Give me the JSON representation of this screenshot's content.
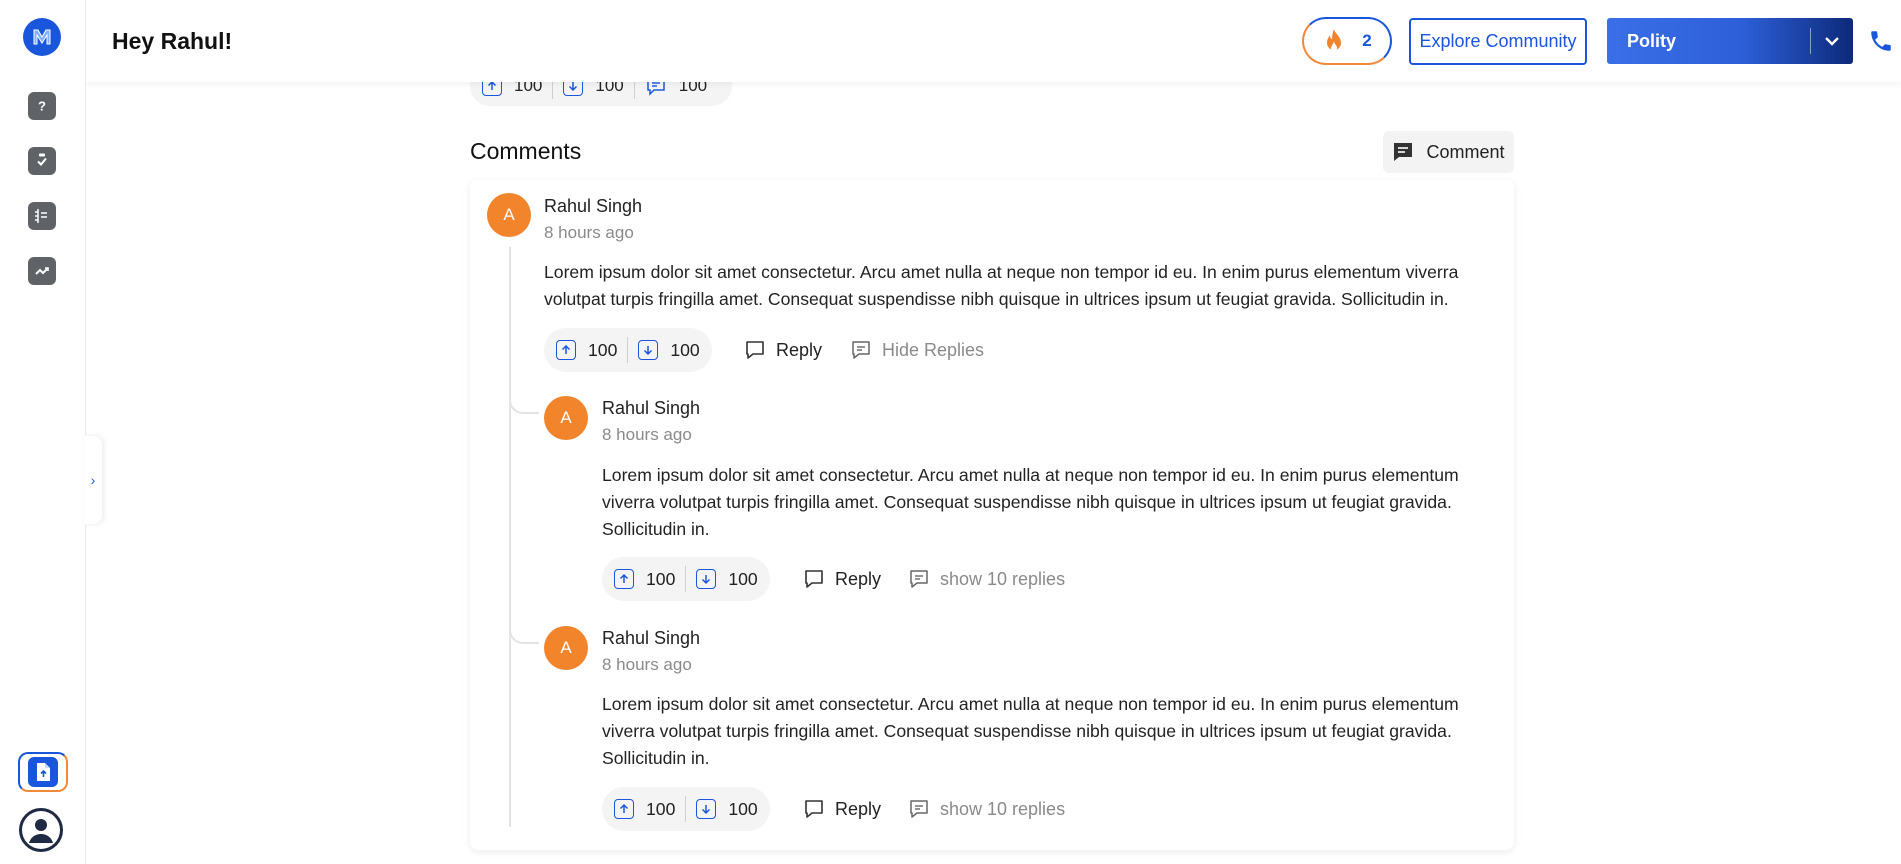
{
  "app": {
    "greeting": "Hey Rahul!",
    "logo_letter": "M",
    "brand_color": "#1a56db",
    "accent_color": "#f2842c"
  },
  "header": {
    "streak_count": "2",
    "explore_label": "Explore Community",
    "dropdown_label": "Polity"
  },
  "sidebar": {
    "items": [
      {
        "icon": "question-icon"
      },
      {
        "icon": "clipboard-check-icon"
      },
      {
        "icon": "notebook-icon"
      },
      {
        "icon": "trend-chart-icon"
      }
    ],
    "toggle_glyph": "›"
  },
  "post_votes": {
    "up": "100",
    "down": "100",
    "comments": "100"
  },
  "comments_section": {
    "title": "Comments",
    "comment_button": "Comment"
  },
  "comments": [
    {
      "avatar_initial": "A",
      "author": "Rahul Singh",
      "time": "8 hours ago",
      "text": "Lorem ipsum dolor sit amet consectetur. Arcu amet nulla at neque non tempor id eu. In enim purus elementum viverra volutpat turpis fringilla amet. Consequat suspendisse nibh quisque in ultrices ipsum ut feugiat gravida. Sollicitudin in.",
      "up": "100",
      "down": "100",
      "reply_label": "Reply",
      "replies_label": "Hide Replies"
    },
    {
      "avatar_initial": "A",
      "author": "Rahul Singh",
      "time": "8 hours ago",
      "text": "Lorem ipsum dolor sit amet consectetur. Arcu amet nulla at neque non tempor id eu. In enim purus elementum viverra volutpat turpis fringilla amet. Consequat suspendisse nibh quisque in ultrices ipsum ut feugiat gravida. Sollicitudin in.",
      "up": "100",
      "down": "100",
      "reply_label": "Reply",
      "replies_label": "show 10 replies"
    },
    {
      "avatar_initial": "A",
      "author": "Rahul Singh",
      "time": "8 hours ago",
      "text": "Lorem ipsum dolor sit amet consectetur. Arcu amet nulla at neque non tempor id eu. In enim purus elementum viverra volutpat turpis fringilla amet. Consequat suspendisse nibh quisque in ultrices ipsum ut feugiat gravida. Sollicitudin in.",
      "up": "100",
      "down": "100",
      "reply_label": "Reply",
      "replies_label": "show 10 replies"
    }
  ]
}
